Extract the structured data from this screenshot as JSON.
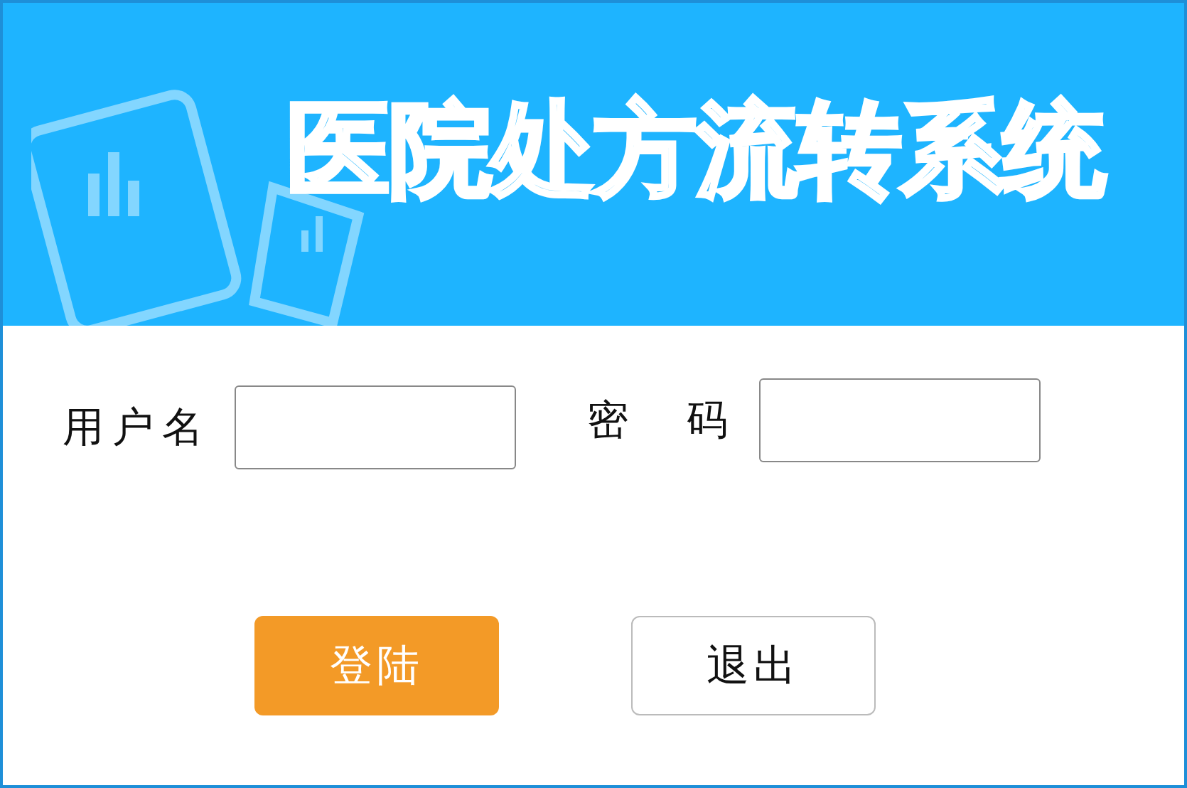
{
  "header": {
    "title": "医院处方流转系统"
  },
  "fields": [
    {
      "label": "用户名"
    },
    {
      "label": "密　码"
    }
  ],
  "buttons": [
    {
      "label": "登陆",
      "kind": "primary"
    },
    {
      "label": "退出",
      "kind": "secondary"
    }
  ]
}
